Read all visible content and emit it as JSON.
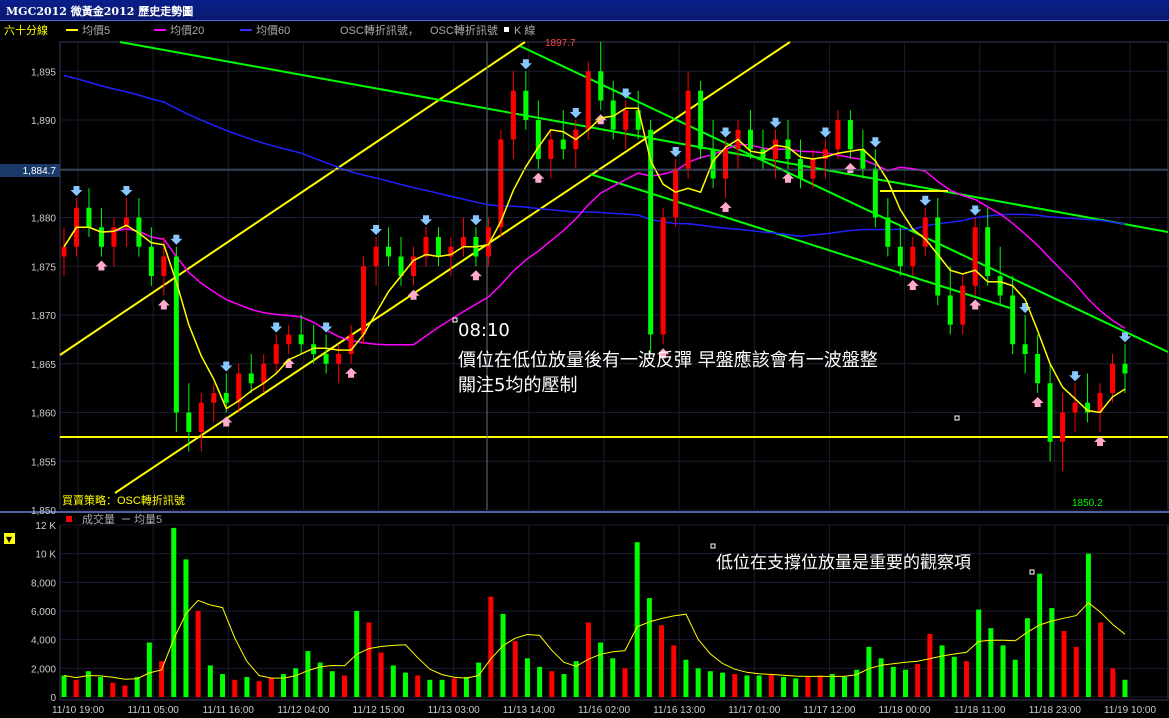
{
  "window": {
    "title": "MGC2012 微黃金2012 歷史走勢圖"
  },
  "legend": {
    "period": "六十分線",
    "ma5": "均價5",
    "ma20": "均價20",
    "ma60": "均價60",
    "osc1": "OSC轉折訊號，",
    "osc2": "OSC轉折訊號",
    "k": "K 線"
  },
  "strategy_label": "買賣策略：OSC轉折訊號",
  "volume_legend": {
    "volume": "成交量",
    "ma": "均量5"
  },
  "annotations": {
    "time": "08:10",
    "line1": "價位在低位放量後有一波反彈  早盤應該會有一波盤整",
    "line2": "關注5均的壓制",
    "volume_note": "低位在支撐位放量是重要的觀察項"
  },
  "colors": {
    "up": "#ff0000",
    "down": "#00ff00",
    "ma5": "#ffff00",
    "ma20": "#ff00ff",
    "ma60": "#0000ff",
    "trend_green": "#00ff00",
    "trend_yellow": "#ffff00"
  },
  "chart_data": [
    {
      "type": "candlestick",
      "ylim": [
        1850,
        1898
      ],
      "y_ticks": [
        "1,850",
        "1,855",
        "1,860",
        "1,865",
        "1,870",
        "1,875",
        "1,880",
        "1,885",
        "1,890",
        "1,895"
      ],
      "current_price_label": "1,884.7",
      "high_label": "1897.7",
      "low_label": "1850.2",
      "support_level": 1856.7,
      "x_ticks": [
        "11/10 19:00",
        "11/11 05:00",
        "11/11 16:00",
        "11/12 04:00",
        "11/12 15:00",
        "11/13 03:00",
        "11/13 14:00",
        "11/16 02:00",
        "11/16 13:00",
        "11/17 01:00",
        "11/17 12:00",
        "11/18 00:00",
        "11/18 11:00",
        "11/18 23:00",
        "11/19 10:00"
      ],
      "ohlc": [
        [
          1876,
          1879,
          1874,
          1877
        ],
        [
          1877,
          1882,
          1876,
          1881
        ],
        [
          1881,
          1883,
          1878,
          1879
        ],
        [
          1879,
          1881,
          1876,
          1877
        ],
        [
          1877,
          1880,
          1875,
          1879
        ],
        [
          1879,
          1882,
          1877,
          1880
        ],
        [
          1880,
          1882,
          1876,
          1877
        ],
        [
          1877,
          1879,
          1873,
          1874
        ],
        [
          1874,
          1878,
          1872,
          1876
        ],
        [
          1876,
          1877,
          1858,
          1860
        ],
        [
          1860,
          1863,
          1856,
          1858
        ],
        [
          1858,
          1862,
          1856,
          1861
        ],
        [
          1861,
          1863,
          1859,
          1862
        ],
        [
          1862,
          1864,
          1860,
          1861
        ],
        [
          1861,
          1865,
          1860,
          1864
        ],
        [
          1864,
          1866,
          1862,
          1863
        ],
        [
          1863,
          1866,
          1862,
          1865
        ],
        [
          1865,
          1868,
          1864,
          1867
        ],
        [
          1867,
          1869,
          1866,
          1868
        ],
        [
          1868,
          1870,
          1866,
          1867
        ],
        [
          1867,
          1869,
          1865,
          1866
        ],
        [
          1866,
          1868,
          1864,
          1865
        ],
        [
          1865,
          1867,
          1863,
          1866
        ],
        [
          1866,
          1869,
          1865,
          1868
        ],
        [
          1868,
          1876,
          1867,
          1875
        ],
        [
          1875,
          1878,
          1873,
          1877
        ],
        [
          1877,
          1879,
          1875,
          1876
        ],
        [
          1876,
          1878,
          1873,
          1874
        ],
        [
          1874,
          1877,
          1873,
          1876
        ],
        [
          1876,
          1879,
          1875,
          1878
        ],
        [
          1878,
          1879,
          1875,
          1876
        ],
        [
          1876,
          1878,
          1874,
          1877
        ],
        [
          1877,
          1880,
          1876,
          1878
        ],
        [
          1878,
          1879,
          1875,
          1876
        ],
        [
          1876,
          1880,
          1875,
          1879
        ],
        [
          1879,
          1889,
          1878,
          1888
        ],
        [
          1888,
          1895,
          1886,
          1893
        ],
        [
          1893,
          1895,
          1889,
          1890
        ],
        [
          1890,
          1892,
          1885,
          1886
        ],
        [
          1886,
          1889,
          1884,
          1888
        ],
        [
          1888,
          1891,
          1886,
          1887
        ],
        [
          1887,
          1890,
          1885,
          1889
        ],
        [
          1889,
          1896,
          1888,
          1895
        ],
        [
          1895,
          1898,
          1891,
          1892
        ],
        [
          1892,
          1894,
          1888,
          1889
        ],
        [
          1889,
          1892,
          1887,
          1891
        ],
        [
          1891,
          1893,
          1888,
          1889
        ],
        [
          1889,
          1890,
          1866,
          1868
        ],
        [
          1868,
          1881,
          1867,
          1880
        ],
        [
          1880,
          1886,
          1879,
          1885
        ],
        [
          1885,
          1895,
          1884,
          1893
        ],
        [
          1893,
          1894,
          1886,
          1887
        ],
        [
          1887,
          1890,
          1883,
          1884
        ],
        [
          1884,
          1888,
          1882,
          1887
        ],
        [
          1887,
          1890,
          1885,
          1889
        ],
        [
          1889,
          1891,
          1886,
          1887
        ],
        [
          1887,
          1889,
          1885,
          1886
        ],
        [
          1886,
          1889,
          1884,
          1888
        ],
        [
          1888,
          1890,
          1885,
          1886
        ],
        [
          1886,
          1888,
          1883,
          1884
        ],
        [
          1884,
          1887,
          1883,
          1886
        ],
        [
          1886,
          1888,
          1884,
          1887
        ],
        [
          1887,
          1891,
          1886,
          1890
        ],
        [
          1890,
          1891,
          1886,
          1887
        ],
        [
          1887,
          1889,
          1884,
          1885
        ],
        [
          1885,
          1887,
          1879,
          1880
        ],
        [
          1880,
          1882,
          1876,
          1877
        ],
        [
          1877,
          1879,
          1874,
          1875
        ],
        [
          1875,
          1878,
          1874,
          1877
        ],
        [
          1877,
          1881,
          1876,
          1880
        ],
        [
          1880,
          1882,
          1871,
          1872
        ],
        [
          1872,
          1875,
          1868,
          1869
        ],
        [
          1869,
          1874,
          1868,
          1873
        ],
        [
          1873,
          1880,
          1872,
          1879
        ],
        [
          1879,
          1881,
          1873,
          1874
        ],
        [
          1874,
          1877,
          1871,
          1872
        ],
        [
          1872,
          1874,
          1866,
          1867
        ],
        [
          1867,
          1870,
          1864,
          1866
        ],
        [
          1866,
          1868,
          1862,
          1863
        ],
        [
          1863,
          1865,
          1855,
          1857
        ],
        [
          1857,
          1862,
          1854,
          1860
        ],
        [
          1860,
          1863,
          1858,
          1861
        ],
        [
          1861,
          1864,
          1859,
          1860
        ],
        [
          1860,
          1863,
          1858,
          1862
        ],
        [
          1862,
          1866,
          1861,
          1865
        ],
        [
          1865,
          1867,
          1862,
          1864
        ]
      ],
      "ma5_label": "均價5",
      "ma20_label": "均價20",
      "ma60_label": "均價60"
    },
    {
      "type": "bar",
      "ylim": [
        0,
        12000
      ],
      "y_ticks": [
        "0",
        "2,000",
        "4,000",
        "6,000",
        "8,000",
        "10 K",
        "12 K"
      ],
      "values": [
        1500,
        1200,
        1800,
        1400,
        1000,
        800,
        1400,
        3800,
        2500,
        11800,
        9600,
        6000,
        2200,
        1600,
        1200,
        1400,
        1100,
        1300,
        1600,
        2000,
        3200,
        2400,
        1800,
        1500,
        6000,
        5200,
        3100,
        2200,
        1700,
        1500,
        1200,
        1200,
        1300,
        1400,
        2400,
        7000,
        5800,
        3900,
        2700,
        2100,
        1800,
        1600,
        2500,
        5200,
        3800,
        2700,
        2000,
        10800,
        6900,
        5000,
        3600,
        2600,
        2000,
        1800,
        1700,
        1600,
        1500,
        1500,
        1600,
        1400,
        1300,
        1400,
        1500,
        1600,
        1400,
        1900,
        3500,
        2700,
        2100,
        1900,
        2300,
        4400,
        3600,
        2800,
        2500,
        6100,
        4800,
        3600,
        2600,
        5500,
        8600,
        6200,
        4600,
        3500,
        10000,
        5200,
        2000,
        1200
      ]
    }
  ]
}
